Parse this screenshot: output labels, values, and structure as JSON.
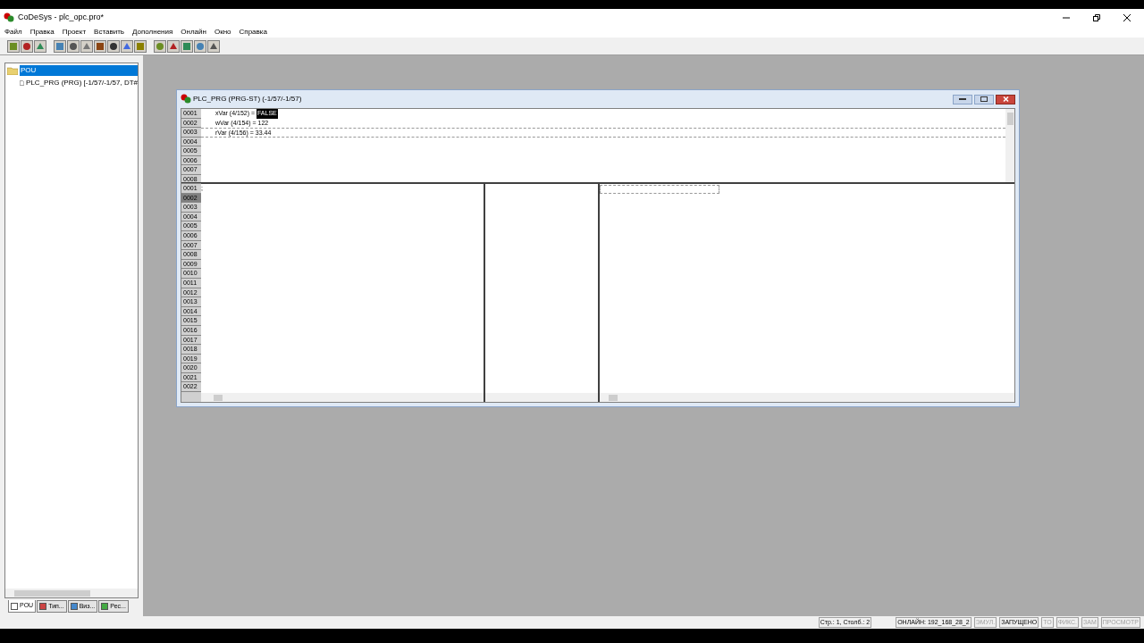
{
  "window": {
    "title": "CoDeSys - plc_opc.pro*"
  },
  "menu": [
    "Файл",
    "Правка",
    "Проект",
    "Вставить",
    "Дополнения",
    "Онлайн",
    "Окно",
    "Справка"
  ],
  "tree": {
    "label": "POU",
    "selected": true,
    "children": [
      {
        "label": "PLC_PRG (PRG) [-1/57/-1/57, DT#",
        "selected": false
      }
    ]
  },
  "tabs": [
    {
      "label": "POU",
      "selected": true
    },
    {
      "label": "Тип...",
      "selected": false
    },
    {
      "label": "Виз...",
      "selected": false
    },
    {
      "label": "Рес...",
      "selected": false
    }
  ],
  "editor": {
    "title": "PLC_PRG (PRG-ST) (-1/57/-1/57)",
    "declarations": [
      {
        "number": "0001",
        "text": "xVar (4/152) = ",
        "value": "FALSE"
      },
      {
        "number": "0002",
        "text": "wVar (4/154) = 122"
      },
      {
        "number": "0003",
        "text": "rVar (4/156) = 33.44"
      },
      {
        "number": "0004"
      },
      {
        "number": "0005"
      },
      {
        "number": "0006"
      },
      {
        "number": "0007"
      },
      {
        "number": "0008"
      }
    ],
    "body": [
      {
        "number": "0001",
        "text": ";",
        "selected": false
      },
      {
        "number": "0002",
        "selected": true
      },
      {
        "number": "0003",
        "selected": false
      },
      {
        "number": "0004",
        "selected": false
      },
      {
        "number": "0005",
        "selected": false
      },
      {
        "number": "0006",
        "selected": false
      },
      {
        "number": "0007",
        "selected": false
      },
      {
        "number": "0008",
        "selected": false
      },
      {
        "number": "0009",
        "selected": false
      },
      {
        "number": "0010",
        "selected": false
      },
      {
        "number": "0011",
        "selected": false
      },
      {
        "number": "0012",
        "selected": false
      },
      {
        "number": "0013",
        "selected": false
      },
      {
        "number": "0014",
        "selected": false
      },
      {
        "number": "0015",
        "selected": false
      },
      {
        "number": "0016",
        "selected": false
      },
      {
        "number": "0017",
        "selected": false
      },
      {
        "number": "0018",
        "selected": false
      },
      {
        "number": "0019",
        "selected": false
      },
      {
        "number": "0020",
        "selected": false
      },
      {
        "number": "0021",
        "selected": false
      },
      {
        "number": "0022",
        "selected": false
      }
    ]
  },
  "status_bar": [
    {
      "text": "Стр.: 1, Столб.: 2",
      "disabled": false
    },
    {
      "text": "ОНЛАЙН: 192_168_28_2",
      "disabled": false
    },
    {
      "text": "ЭМУЛ.",
      "disabled": true
    },
    {
      "text": "ЗАПУЩЕНО",
      "disabled": false
    },
    {
      "text": "ТО",
      "disabled": true
    },
    {
      "text": "ФИКС.",
      "disabled": true
    },
    {
      "text": "ЗАМ",
      "disabled": true
    },
    {
      "text": "ПРОСМОТР",
      "disabled": true
    }
  ]
}
